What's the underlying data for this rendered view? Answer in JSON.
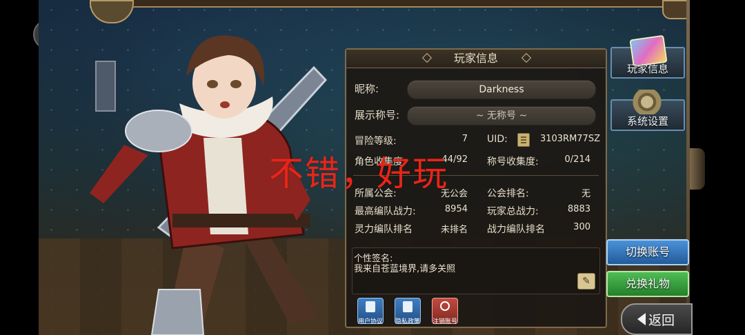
{
  "panel": {
    "title": "玩家信息",
    "nickname_label": "昵称:",
    "nickname_value": "Darkness",
    "display_title_label": "展示称号:",
    "display_title_value": "~ 无称号 ~",
    "adventure_level_label": "冒险等级:",
    "adventure_level_value": "7",
    "uid_label": "UID:",
    "uid_value": "3103RM77SZ",
    "character_collection_label": "角色收集度:",
    "character_collection_value": "44/92",
    "title_collection_label": "称号收集度:",
    "title_collection_value": "0/214",
    "guild_label": "所属公会:",
    "guild_value": "无公会",
    "guild_rank_label": "公会排名:",
    "guild_rank_value": "无",
    "max_team_power_label": "最高编队战力:",
    "max_team_power_value": "8954",
    "total_power_label": "玩家总战力:",
    "total_power_value": "8883",
    "spirit_team_rank_label": "灵力编队排名",
    "spirit_team_rank_value": "未排名",
    "power_team_rank_label": "战力编队排名",
    "power_team_rank_value": "300",
    "signature_label": "个性签名:",
    "signature_value": "我来自苍蓝境界,请多关照",
    "buttons": {
      "user_agreement": "用户协议",
      "privacy_policy": "隐私政策",
      "cancel_account": "注销账号"
    }
  },
  "overlay_text": "不错，好玩",
  "side": {
    "player_info": "玩家信息",
    "system_settings": "系统设置",
    "switch_account": "切换账号",
    "redeem_gift": "兑换礼物",
    "back": "返回"
  },
  "colors": {
    "overlay": "#ea2418",
    "panel_bg": "#1c1814",
    "panel_border": "#7d6a4c",
    "blue_button": "#3a7cc4",
    "green_button": "#3fa546",
    "red_button": "#b5423a"
  },
  "icons": [
    "chevron-right-icon",
    "document-icon",
    "shield-icon",
    "power-icon",
    "pencil-icon",
    "copy-icon",
    "back-arrow-icon",
    "gear-icon",
    "cards-icon"
  ]
}
